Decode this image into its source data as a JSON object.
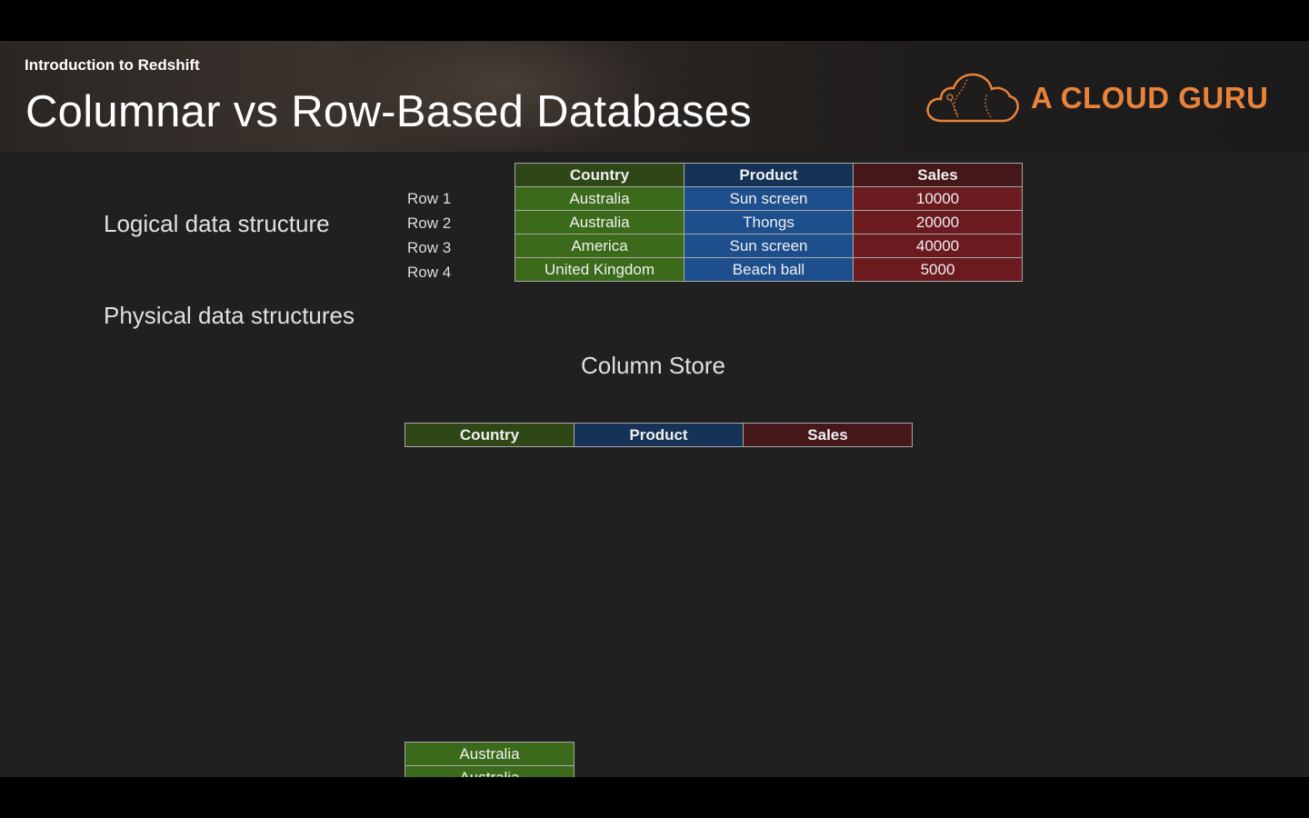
{
  "header": {
    "subtitle": "Introduction to Redshift",
    "title": "Columnar vs Row-Based Databases",
    "logo_text": "A CLOUD GURU",
    "logo_icon": "cloud-icon",
    "brand_color": "#e8833a"
  },
  "labels": {
    "logical": "Logical data structure",
    "physical": "Physical data structures",
    "column_store": "Column Store"
  },
  "logical_table": {
    "columns": [
      "Country",
      "Product",
      "Sales"
    ],
    "rows": [
      {
        "label": "Row 1",
        "cells": [
          "Australia",
          "Sun screen",
          "10000"
        ]
      },
      {
        "label": "Row 2",
        "cells": [
          "Australia",
          "Thongs",
          "20000"
        ]
      },
      {
        "label": "Row 3",
        "cells": [
          "America",
          "Sun screen",
          "40000"
        ]
      },
      {
        "label": "Row 4",
        "cells": [
          "United Kingdom",
          "Beach ball",
          "5000"
        ]
      }
    ]
  },
  "column_store": {
    "columns": [
      "Country",
      "Product",
      "Sales"
    ],
    "country_values": [
      "Australia",
      "Australia"
    ]
  },
  "colors": {
    "country": "#3b6b1a",
    "product": "#1e4f8d",
    "sales": "#6b1b1f"
  }
}
